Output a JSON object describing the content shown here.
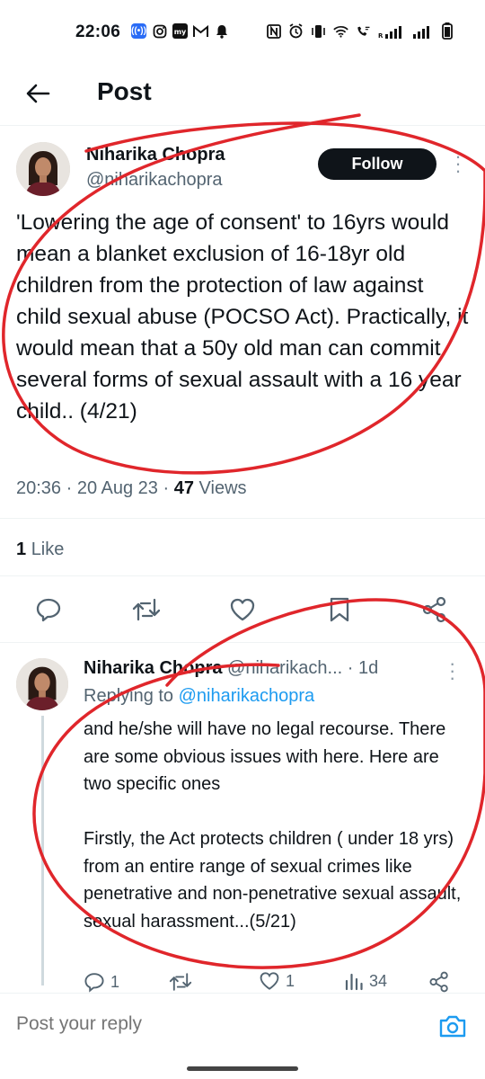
{
  "status_bar": {
    "time": "22:06",
    "left_icons": [
      "radio-app-icon",
      "instagram-icon",
      "myjio-icon",
      "gmail-icon",
      "notification-bell-icon"
    ],
    "right_icons": [
      "nfc-icon",
      "alarm-icon",
      "vibrate-icon",
      "wifi-icon",
      "wifi-calling-icon",
      "signal-icon",
      "signal-icon",
      "battery-icon"
    ]
  },
  "header": {
    "back_icon": "arrow-left-icon",
    "title": "Post"
  },
  "tweet": {
    "author_name": "Niharika Chopra",
    "author_handle": "@niharikachopra",
    "follow_label": "Follow",
    "text": "'Lowering the age of consent' to 16yrs would mean a blanket exclusion of 16-18yr old children from the protection of law against child sexual abuse (POCSO Act). Practically, it would mean that a 50y old man can commit several forms of sexual assault with a 16 year child.. (4/21)",
    "time": "20:36",
    "date": "20 Aug 23",
    "views_count": "47",
    "views_label": "Views",
    "likes_count": "1",
    "likes_label": "Like",
    "actions": [
      "reply-icon",
      "retweet-icon",
      "like-icon",
      "bookmark-icon",
      "share-icon"
    ]
  },
  "reply": {
    "author_name": "Niharika Chopra",
    "author_handle": "@niharikach...",
    "age": "· 1d",
    "replying_prefix": "Replying to",
    "replying_handle": "@niharikachopra",
    "text": "and he/she will have no legal recourse. There are some obvious issues with here. Here are two specific ones\n\nFirstly, the Act protects children ( under 18 yrs) from an entire range of sexual crimes like penetrative and non-penetrative sexual assault, sexual harassment...(5/21)",
    "reply_count": "1",
    "retweet_count": "",
    "like_count": "1",
    "view_count": "34"
  },
  "reply_box": {
    "placeholder": "Post your reply",
    "camera_icon": "camera-icon"
  },
  "colors": {
    "accent": "#1d9bf0",
    "text": "#0f1419",
    "muted": "#536471",
    "follow_bg": "#0f1419",
    "annotation": "#e0262b"
  }
}
